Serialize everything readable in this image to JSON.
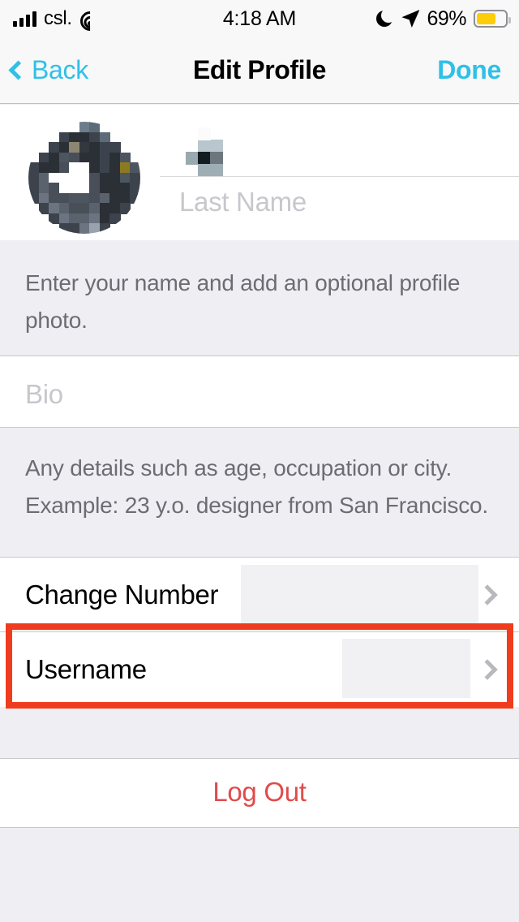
{
  "status_bar": {
    "carrier": "csl.",
    "time": "4:18 AM",
    "battery_percent": "69%",
    "battery_level": 69,
    "icons": [
      "signal-bars-icon",
      "wifi-icon",
      "do-not-disturb-moon-icon",
      "location-arrow-icon",
      "battery-icon"
    ]
  },
  "nav_bar": {
    "back_label": "Back",
    "title": "Edit Profile",
    "done_label": "Done"
  },
  "profile": {
    "avatar_alt": "profile-photo-pixelated",
    "first_name_value": "",
    "first_name_redacted": true,
    "last_name_placeholder": "Last Name",
    "name_hint": "Enter your name and add an optional profile photo."
  },
  "bio": {
    "placeholder": "Bio",
    "value": "",
    "hint": "Any details such as age, occupation or city. Example: 23 y.o. designer from San Francisco."
  },
  "rows": [
    {
      "label": "Change Number",
      "value": "",
      "value_redacted": true,
      "accessory": "chevron-right-icon"
    },
    {
      "label": "Username",
      "value": "",
      "value_redacted": true,
      "accessory": "chevron-right-icon"
    }
  ],
  "logout": {
    "label": "Log Out"
  },
  "annotation": {
    "target": "Username",
    "color": "#f03c1e"
  },
  "colors": {
    "accent": "#2fc0e8",
    "destructive": "#e04b4b",
    "background": "#eeeef3",
    "surface": "#ffffff",
    "separator": "#c8c7cc",
    "placeholder": "#c7c7cc",
    "hint_text": "#6c6c72",
    "battery_fill": "#fdcd0a",
    "annotation": "#f03c1e"
  }
}
